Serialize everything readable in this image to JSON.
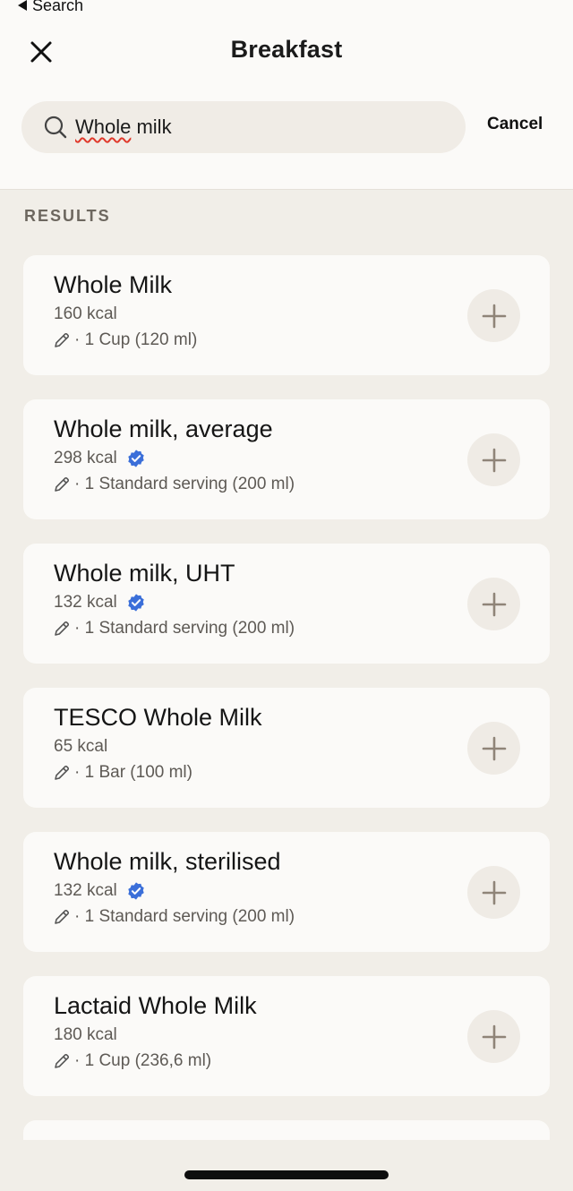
{
  "status_bar": {
    "back_label": "Search"
  },
  "header": {
    "title": "Breakfast",
    "search_value": "Whole milk",
    "search_value_first": "Whole",
    "search_value_rest": " milk",
    "cancel_label": "Cancel"
  },
  "results": {
    "label": "RESULTS",
    "items": [
      {
        "name": "Whole Milk",
        "kcal": "160 kcal",
        "verified": false,
        "serving": "· 1 Cup (120 ml)"
      },
      {
        "name": "Whole milk, average",
        "kcal": "298 kcal",
        "verified": true,
        "serving": "· 1 Standard serving (200 ml)"
      },
      {
        "name": "Whole milk, UHT",
        "kcal": "132 kcal",
        "verified": true,
        "serving": "· 1 Standard serving (200 ml)"
      },
      {
        "name": "TESCO Whole Milk",
        "kcal": "65 kcal",
        "verified": false,
        "serving": "· 1 Bar (100 ml)"
      },
      {
        "name": "Whole milk, sterilised",
        "kcal": "132 kcal",
        "verified": true,
        "serving": "· 1 Standard serving (200 ml)"
      },
      {
        "name": "Lactaid Whole Milk",
        "kcal": "180 kcal",
        "verified": false,
        "serving": "· 1 Cup (236,6 ml)"
      }
    ]
  },
  "colors": {
    "background": "#f1eee8",
    "card": "#fbfaf8",
    "verified_badge": "#3b6fd9",
    "accent_button": "#efebe5"
  },
  "icons": [
    "close-icon",
    "search-icon",
    "verified-icon",
    "pencil-icon",
    "plus-icon"
  ]
}
